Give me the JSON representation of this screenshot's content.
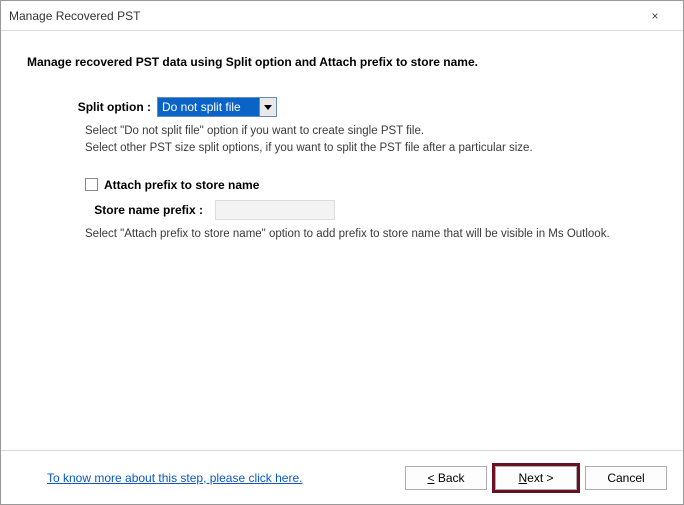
{
  "window": {
    "title": "Manage Recovered PST",
    "close_label": "×"
  },
  "heading": "Manage recovered PST data using Split option and Attach prefix to store name.",
  "split": {
    "label": "Split option :",
    "selected": "Do not split file",
    "help_line1": "Select \"Do not split file\" option if you want to create single PST file.",
    "help_line2": "Select other PST size split options, if you want to split the PST file after a particular size."
  },
  "prefix": {
    "checkbox_label": "Attach prefix to store name",
    "checked": false,
    "input_label": "Store name prefix :",
    "input_value": "",
    "help": "Select \"Attach prefix to store name\" option to add prefix to store name that will be visible in Ms Outlook."
  },
  "footer": {
    "link": "To know more about this step, please click here.",
    "back": "< Back",
    "next": "Next >",
    "cancel": "Cancel"
  }
}
